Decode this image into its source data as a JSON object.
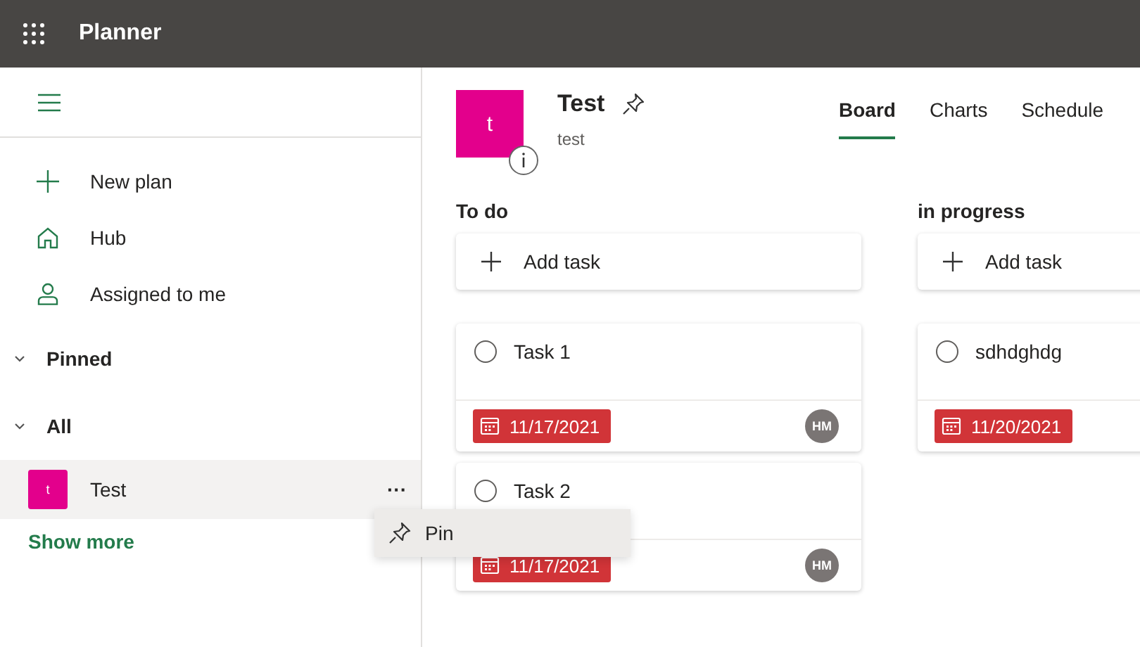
{
  "app_title": "Planner",
  "sidebar": {
    "nav": [
      {
        "kind": "new",
        "label": "New plan"
      },
      {
        "kind": "hub",
        "label": "Hub"
      },
      {
        "kind": "assigned",
        "label": "Assigned to me"
      }
    ],
    "pinned": {
      "label": "Pinned",
      "expanded": true
    },
    "all": {
      "label": "All",
      "expanded": true
    },
    "plans": [
      {
        "initial": "t",
        "name": "Test",
        "selected": true,
        "more": "···"
      }
    ],
    "show_more": "Show more"
  },
  "context_menu": {
    "label": "Pin"
  },
  "plan": {
    "initial": "t",
    "title": "Test",
    "subtitle": "test"
  },
  "tabs": [
    {
      "label": "Board",
      "selected": true
    },
    {
      "label": "Charts",
      "selected": false
    },
    {
      "label": "Schedule",
      "selected": false
    }
  ],
  "buckets": [
    {
      "name": "To do",
      "add_label": "Add task",
      "tasks": [
        {
          "title": "Task 1",
          "checked": false,
          "due": "11/17/2021",
          "assignee": "HM"
        },
        {
          "title": "Task 2",
          "checked": false,
          "due": "11/17/2021",
          "assignee": "HM"
        }
      ]
    },
    {
      "name": "in progress",
      "add_label": "Add task",
      "tasks": [
        {
          "title": "sdhdghdg",
          "checked": false,
          "due": "11/20/2021"
        }
      ]
    }
  ]
}
